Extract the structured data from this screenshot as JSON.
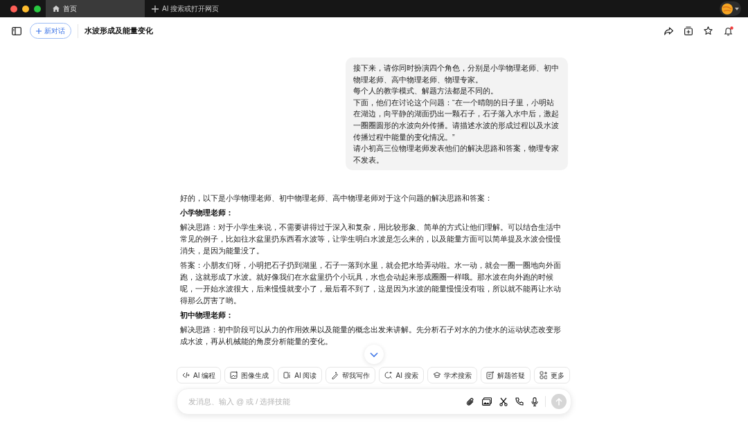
{
  "tabs": [
    {
      "label": "首页",
      "selected": true
    }
  ],
  "new_tab": {
    "label": "AI 搜索或打开网页"
  },
  "header": {
    "new_chat": "新对话",
    "title": "水波形成及能量变化",
    "notification": true
  },
  "user_message": [
    "接下来，请你同时扮演四个角色，分别是小学物理老师、初中物理老师、高中物理老师、物理专家。",
    "每个人的教学模式、解题方法都是不同的。",
    "下面，他们在讨论这个问题：“在一个晴朗的日子里，小明站在湖边，向平静的湖面扔出一颗石子，石子落入水中后，激起一圈圈圆形的水波向外传播。请描述水波的形成过程以及水波传播过程中能量的变化情况。”",
    "请小初高三位物理老师发表他们的解决思路和答案，物理专家不发表。"
  ],
  "assistant_message": [
    {
      "kind": "text",
      "text": "好的，以下是小学物理老师、初中物理老师、高中物理老师对于这个问题的解决思路和答案："
    },
    {
      "kind": "heading",
      "text": "小学物理老师："
    },
    {
      "kind": "text",
      "text": "解决思路：对于小学生来说，不需要讲得过于深入和复杂，用比较形象、简单的方式让他们理解。可以结合生活中常见的例子，比如往水盆里扔东西看水波等，让学生明白水波是怎么来的，以及能量方面可以简单提及水波会慢慢消失，是因为能量没了。"
    },
    {
      "kind": "text",
      "text": "答案：小朋友们呀，小明把石子扔到湖里，石子一落到水里，就会把水给弄动啦。水一动，就会一圈一圈地向外面跑，这就形成了水波。就好像我们在水盆里扔个小玩具，水也会动起来形成圈圈一样哦。那水波在向外跑的时候呢，一开始水波很大，后来慢慢就变小了，最后看不到了，这是因为水波的能量慢慢没有啦，所以就不能再让水动得那么厉害了哟。"
    },
    {
      "kind": "heading",
      "text": "初中物理老师："
    },
    {
      "kind": "text",
      "text": "解决思路：初中阶段可以从力的作用效果以及能量的概念出发来讲解。先分析石子对水的力使水的运动状态改变形成水波，再从机械能的角度分析能量的变化。"
    }
  ],
  "skills": [
    "AI 编程",
    "图像生成",
    "AI 阅读",
    "帮我写作",
    "AI 搜索",
    "学术搜索",
    "解题答疑",
    "更多"
  ],
  "composer": {
    "placeholder": "发消息、输入 @ 或 / 选择技能",
    "send_disabled": true
  }
}
